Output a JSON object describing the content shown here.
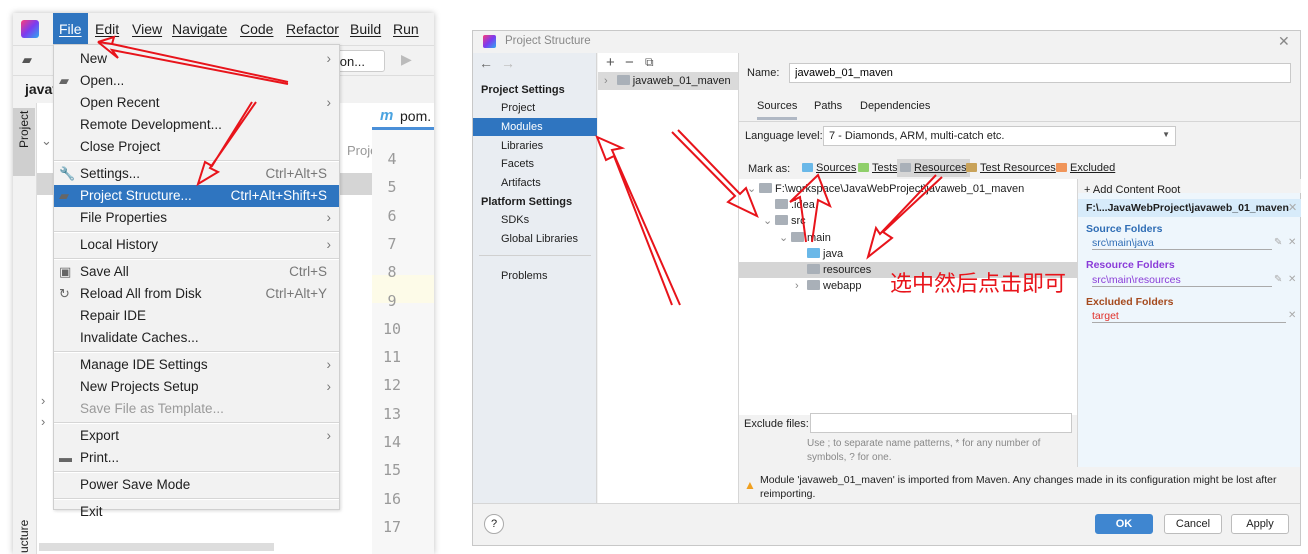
{
  "ide": {
    "menubar": [
      "File",
      "Edit",
      "View",
      "Navigate",
      "Code",
      "Refactor",
      "Build",
      "Run"
    ],
    "toolbar_config_label": "ation...",
    "project_label": "javav",
    "project_tool_window": "Project",
    "structure_tool_window": "ucture",
    "tree_path_fragment": "Proje",
    "editor_tab": "pom.",
    "line_numbers": [
      "4",
      "5",
      "6",
      "7",
      "8",
      "9",
      "10",
      "11",
      "12",
      "13",
      "14",
      "15",
      "16",
      "17"
    ],
    "file_menu": [
      {
        "label": "New",
        "submenu": true
      },
      {
        "label": "Open...",
        "icon": "folder-open-icon"
      },
      {
        "label": "Open Recent",
        "submenu": true
      },
      {
        "label": "Remote Development..."
      },
      {
        "label": "Close Project"
      },
      {
        "sep": true
      },
      {
        "label": "Settings...",
        "shortcut": "Ctrl+Alt+S",
        "icon": "wrench-icon"
      },
      {
        "label": "Project Structure...",
        "shortcut": "Ctrl+Alt+Shift+S",
        "icon": "project-structure-icon",
        "highlighted": true
      },
      {
        "label": "File Properties",
        "submenu": true
      },
      {
        "sep": true
      },
      {
        "label": "Local History",
        "submenu": true
      },
      {
        "sep": true
      },
      {
        "label": "Save All",
        "shortcut": "Ctrl+S",
        "icon": "save-icon"
      },
      {
        "label": "Reload All from Disk",
        "shortcut": "Ctrl+Alt+Y",
        "icon": "reload-icon"
      },
      {
        "label": "Repair IDE"
      },
      {
        "label": "Invalidate Caches..."
      },
      {
        "sep": true
      },
      {
        "label": "Manage IDE Settings",
        "submenu": true
      },
      {
        "label": "New Projects Setup",
        "submenu": true
      },
      {
        "label": "Save File as Template...",
        "disabled": true
      },
      {
        "sep": true
      },
      {
        "label": "Export",
        "submenu": true
      },
      {
        "label": "Print...",
        "icon": "print-icon"
      },
      {
        "sep": true
      },
      {
        "label": "Power Save Mode"
      },
      {
        "sep": true
      },
      {
        "label": "Exit"
      }
    ]
  },
  "dialog": {
    "title": "Project Structure",
    "sidebar": {
      "project_settings": "Project Settings",
      "project_items": [
        "Project",
        "Modules",
        "Libraries",
        "Facets",
        "Artifacts"
      ],
      "selected": "Modules",
      "platform_settings": "Platform Settings",
      "platform_items": [
        "SDKs",
        "Global Libraries"
      ],
      "problems": "Problems"
    },
    "module": "javaweb_01_maven",
    "name_label": "Name:",
    "name_value": "javaweb_01_maven",
    "tabs": [
      "Sources",
      "Paths",
      "Dependencies"
    ],
    "active_tab": "Sources",
    "language_level_label": "Language level:",
    "language_level_value": "7 - Diamonds, ARM, multi-catch etc.",
    "mark_as_label": "Mark as:",
    "mark_as": [
      {
        "label": "Sources",
        "color": "#6ab8e8"
      },
      {
        "label": "Tests",
        "color": "#8fcf6a"
      },
      {
        "label": "Resources",
        "color": "#a9b0b8",
        "active": true
      },
      {
        "label": "Test Resources",
        "color": "#c9a35a"
      },
      {
        "label": "Excluded",
        "color": "#f0955a"
      }
    ],
    "tree": [
      {
        "label": "F:\\workspace\\JavaWebProject\\javaweb_01_maven",
        "depth": 0,
        "expanded": true
      },
      {
        "label": ".idea",
        "depth": 1
      },
      {
        "label": "src",
        "depth": 1,
        "expanded": true
      },
      {
        "label": "main",
        "depth": 2,
        "expanded": true
      },
      {
        "label": "java",
        "depth": 3,
        "color": "#6ab8e8"
      },
      {
        "label": "resources",
        "depth": 3,
        "selected": true
      },
      {
        "label": "webapp",
        "depth": 3,
        "collapsed": true
      }
    ],
    "add_content_root": "Add Content Root",
    "content_root": "F:\\...JavaWebProject\\javaweb_01_maven",
    "source_folders_label": "Source Folders",
    "source_folders": [
      "src\\main\\java"
    ],
    "resource_folders_label": "Resource Folders",
    "resource_folders": [
      "src\\main\\resources"
    ],
    "excluded_folders_label": "Excluded Folders",
    "excluded_folders": [
      "target"
    ],
    "exclude_files_label": "Exclude files:",
    "exclude_files_value": "",
    "exclude_hint": "Use ; to separate name patterns, * for any number of symbols, ? for one.",
    "warning": "Module 'javaweb_01_maven' is imported from Maven. Any changes made in its configuration might be lost after reimporting.",
    "buttons": {
      "ok": "OK",
      "cancel": "Cancel",
      "apply": "Apply"
    },
    "help": "?"
  },
  "annotation": {
    "text": "选中然后点击即可",
    "color": "#e8141b"
  }
}
